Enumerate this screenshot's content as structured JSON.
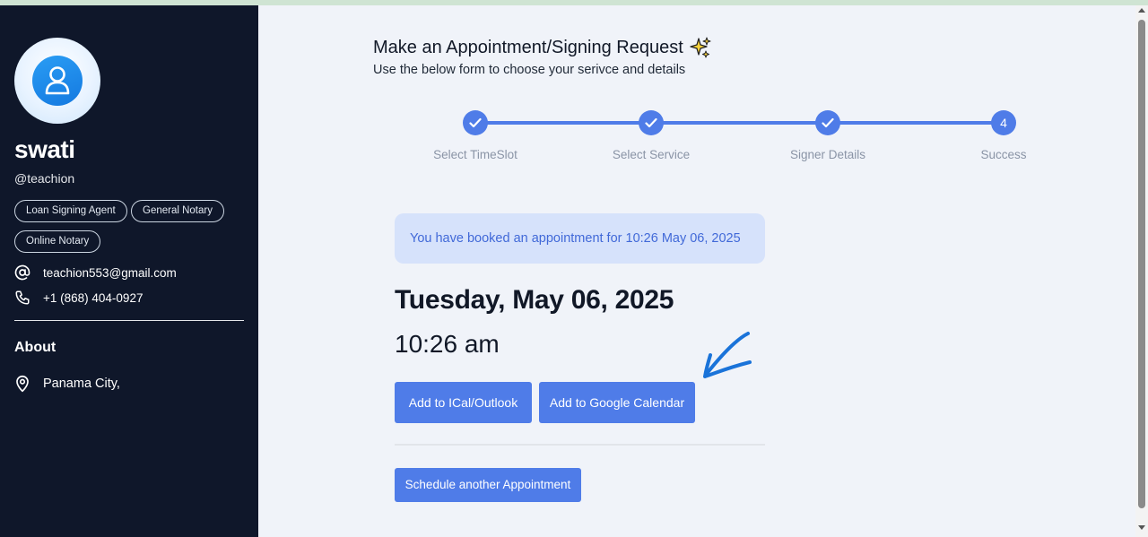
{
  "profile": {
    "name": "swati",
    "handle": "@teachion",
    "tags": [
      "Loan Signing Agent",
      "General Notary",
      "Online Notary"
    ],
    "email": "teachion553@gmail.com",
    "phone": "+1 (868) 404-0927",
    "about_title": "About",
    "location": "Panama City,"
  },
  "header": {
    "title": "Make an Appointment/Signing Request",
    "title_emoji": "sparkles-icon",
    "subtitle": "Use the below form to choose your serivce and details"
  },
  "stepper": {
    "steps": [
      {
        "label": "Select TimeSlot",
        "state": "done"
      },
      {
        "label": "Select Service",
        "state": "done"
      },
      {
        "label": "Signer Details",
        "state": "done"
      },
      {
        "label": "Success",
        "state": "current",
        "number": "4"
      }
    ]
  },
  "result": {
    "notice": "You have booked an appointment for 10:26 May 06, 2025",
    "date": "Tuesday, May 06, 2025",
    "time": "10:26 am",
    "ical_button": "Add to ICal/Outlook",
    "google_button": "Add to Google Calendar",
    "schedule_button": "Schedule another Appointment"
  },
  "colors": {
    "sidebar_bg": "#0f172a",
    "accent": "#4f7ce8",
    "notice_bg": "#d6e2fb",
    "annotation_arrow": "#1a73d9"
  }
}
